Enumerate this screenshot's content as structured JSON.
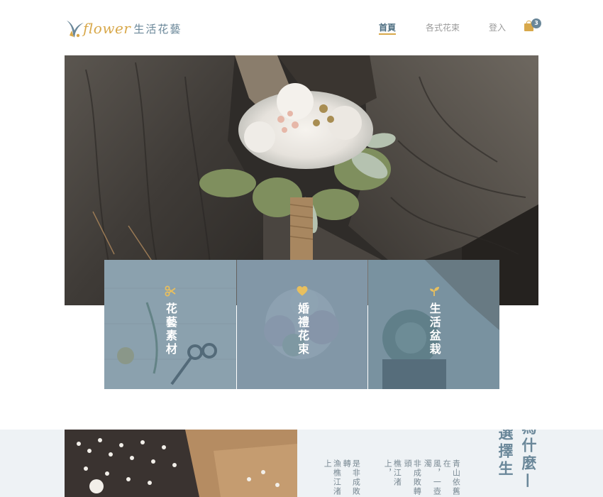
{
  "brand": {
    "logo_script": "flower",
    "logo_cn": "生活花藝",
    "colors": {
      "accent": "#d8a84a",
      "primary": "#6a8799"
    }
  },
  "nav": {
    "items": [
      {
        "label": "首頁",
        "active": true
      },
      {
        "label": "各式花束",
        "active": false
      },
      {
        "label": "登入",
        "active": false
      }
    ],
    "cart": {
      "icon": "shopping-bag-icon",
      "count": "3"
    }
  },
  "hero": {
    "image": "bridal-bouquet-on-tree-trunk"
  },
  "categories": [
    {
      "icon": "scissors-icon",
      "label": "花藝素材"
    },
    {
      "icon": "heart-icon",
      "label": "婚禮花束"
    },
    {
      "icon": "sprout-icon",
      "label": "生活盆栽"
    }
  ],
  "about": {
    "heading_line1": "為什麼—",
    "heading_line2": "選擇生",
    "text_columns": [
      "青山依舊在",
      "風，一壺濁",
      "非成敗轉頭",
      "樵江渚上，",
      "是非成敗轉",
      "漁樵江渚上"
    ]
  }
}
